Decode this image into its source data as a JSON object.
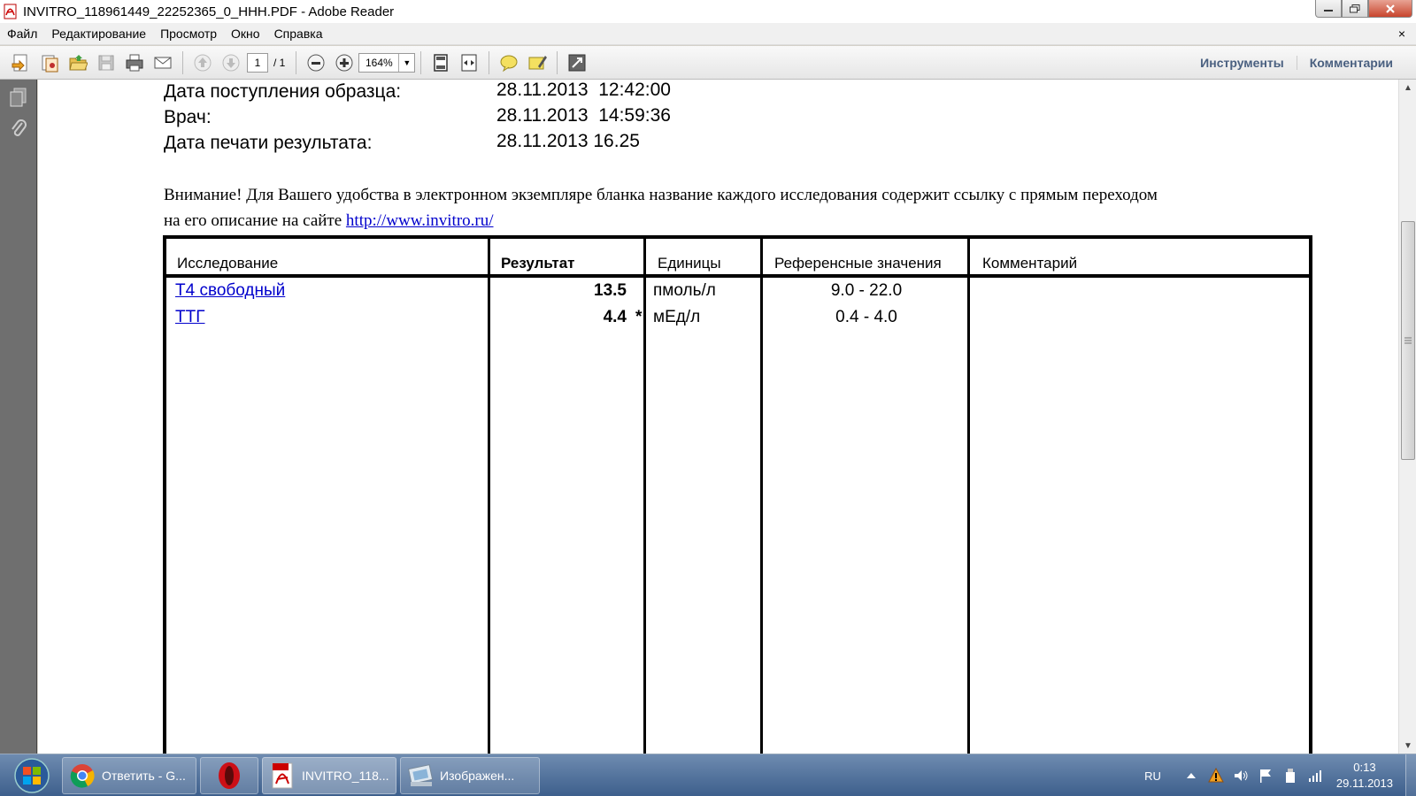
{
  "window": {
    "title": "INVITRO_118961449_22252365_0_HHH.PDF - Adobe Reader"
  },
  "menu": {
    "items": [
      "Файл",
      "Редактирование",
      "Просмотр",
      "Окно",
      "Справка"
    ],
    "close_glyph": "×"
  },
  "toolbar": {
    "page_current": "1",
    "page_total": "/ 1",
    "zoom": "164%",
    "tools_label": "Инструменты",
    "comments_label": "Комментарии"
  },
  "document": {
    "fields": [
      {
        "label": "Дата поступления образца:",
        "value": "28.11.2013  12:42:00"
      },
      {
        "label": "Врач:",
        "value": "28.11.2013  14:59:36"
      },
      {
        "label": "Дата печати результата:",
        "value": "28.11.2013 16.25"
      }
    ],
    "notice_line1": "Внимание! Для Вашего удобства в электронном экземпляре бланка название каждого исследования содержит ссылку с прямым переходом",
    "notice_line2": "на его описание на сайте ",
    "notice_link": "http://www.invitro.ru/",
    "table": {
      "headers": [
        "Исследование",
        "Результат",
        "Единицы",
        "Референсные значения",
        "Комментарий"
      ],
      "rows": [
        {
          "test": "Т4 свободный",
          "result": "13.5",
          "flag": "",
          "units": "пмоль/л",
          "reference": "9.0 - 22.0",
          "comment": ""
        },
        {
          "test": "ТТГ",
          "result": "4.4",
          "flag": "*",
          "units": "мЕд/л",
          "reference": "0.4 - 4.0",
          "comment": ""
        }
      ]
    }
  },
  "taskbar": {
    "tasks": [
      {
        "label": "Ответить - G...",
        "icon": "chrome-icon"
      },
      {
        "label": "",
        "icon": "opera-icon"
      },
      {
        "label": "INVITRO_118...",
        "icon": "pdf-icon"
      },
      {
        "label": "Изображен...",
        "icon": "image-viewer-icon"
      }
    ],
    "language": "RU",
    "time": "0:13",
    "date": "29.11.2013"
  }
}
